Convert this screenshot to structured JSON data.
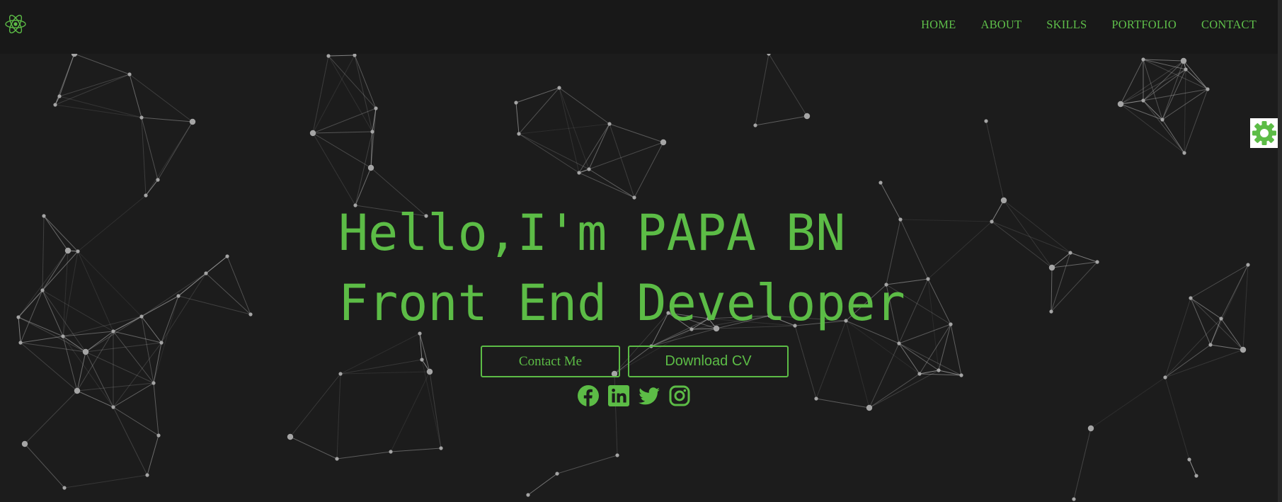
{
  "nav": {
    "items": [
      {
        "label": "HOME"
      },
      {
        "label": "ABOUT"
      },
      {
        "label": "SKILLS"
      },
      {
        "label": "PORTFOLIO"
      },
      {
        "label": "CONTACT"
      }
    ],
    "logo_icon": "react-atom-icon"
  },
  "hero": {
    "greeting": "Hello,I'm PAPA BN",
    "role": "Front End Developer",
    "contact_button": "Contact Me",
    "download_button": "Download CV"
  },
  "socials": [
    {
      "icon": "facebook-icon"
    },
    {
      "icon": "linkedin-icon"
    },
    {
      "icon": "twitter-icon"
    },
    {
      "icon": "instagram-icon"
    }
  ],
  "settings": {
    "icon": "gear-icon"
  },
  "colors": {
    "accent": "#5cbc46",
    "background": "#1c1c1c",
    "navbar": "#181818",
    "particles": "#9a9a9a"
  }
}
